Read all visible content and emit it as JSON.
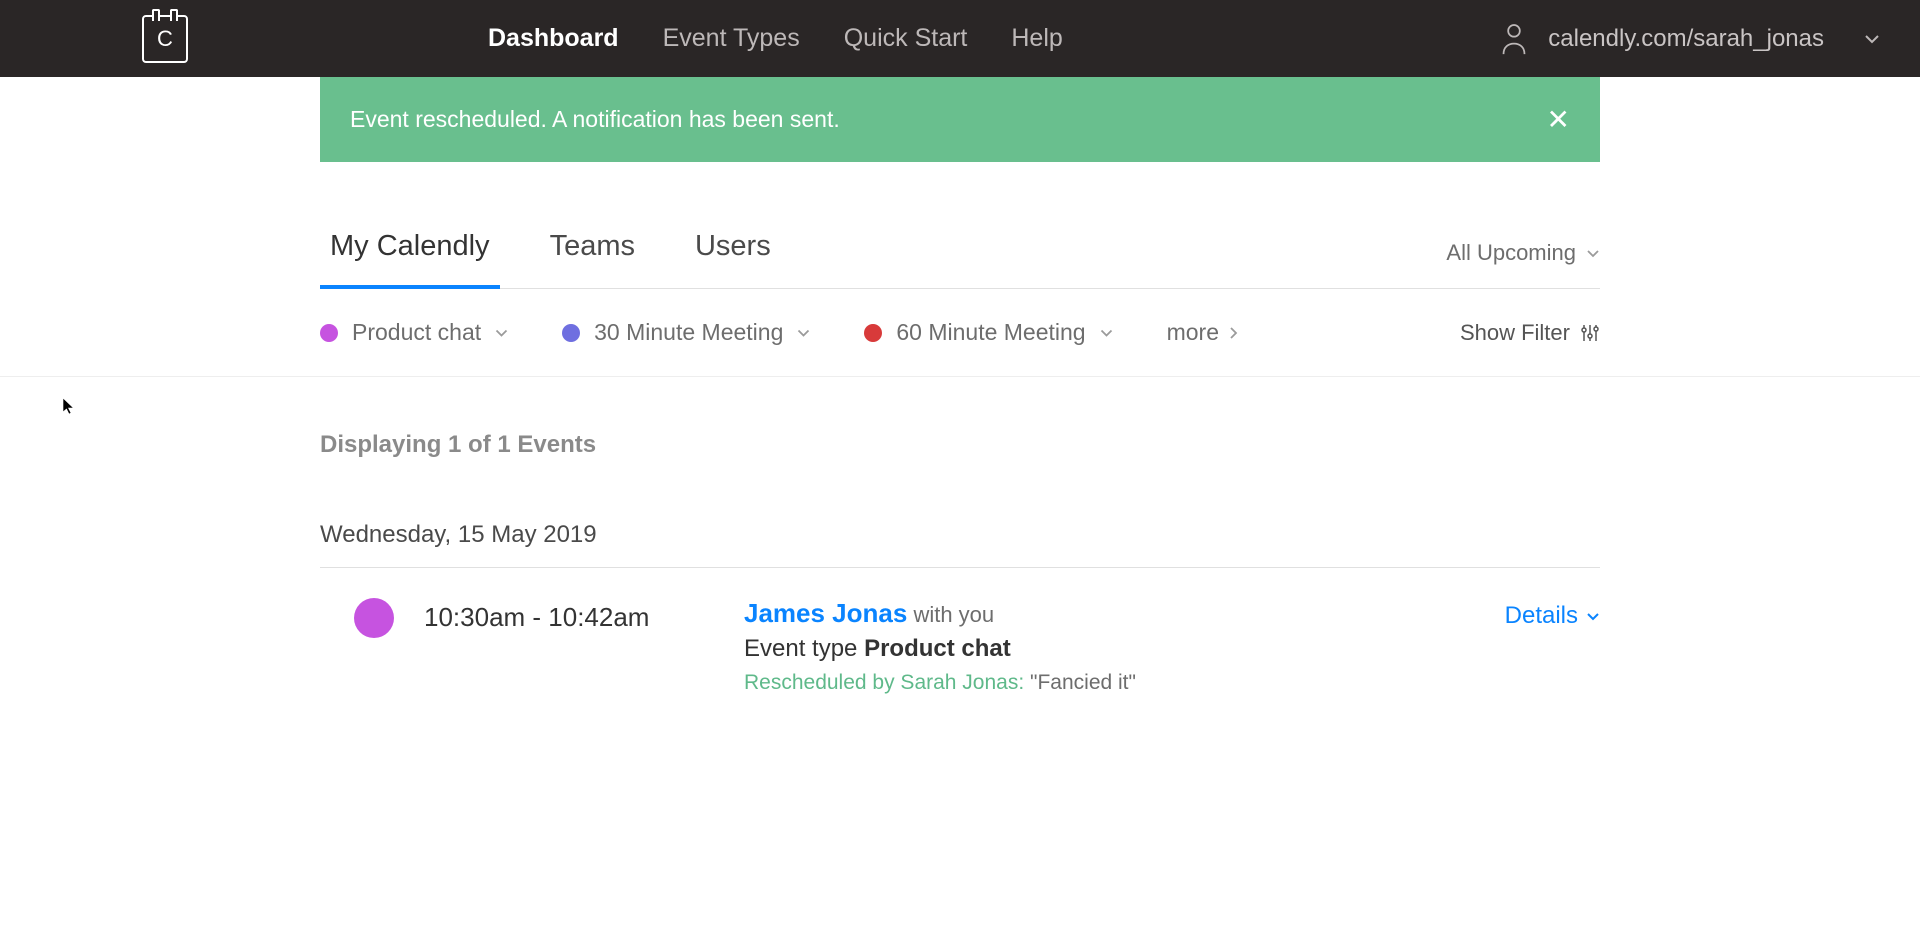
{
  "header": {
    "logo_letter": "C",
    "nav": {
      "dashboard": "Dashboard",
      "event_types": "Event Types",
      "quick_start": "Quick Start",
      "help": "Help"
    },
    "user_url": "calendly.com/sarah_jonas"
  },
  "banner": {
    "message": "Event rescheduled. A notification has been sent."
  },
  "tabs": {
    "my_calendly": "My Calendly",
    "teams": "Teams",
    "users": "Users"
  },
  "upcoming_filter": "All Upcoming",
  "event_type_chips": [
    {
      "label": "Product chat",
      "color": "#c653e0"
    },
    {
      "label": "30 Minute Meeting",
      "color": "#6f6fe0"
    },
    {
      "label": "60 Minute Meeting",
      "color": "#d83a3a"
    }
  ],
  "more_label": "more",
  "show_filter_label": "Show Filter",
  "count_line": "Displaying 1 of 1 Events",
  "date_heading": "Wednesday, 15 May 2019",
  "event": {
    "time": "10:30am - 10:42am",
    "invitee": "James Jonas",
    "with_label": " with you",
    "event_type_prefix": "Event type ",
    "event_type_name": "Product chat",
    "resched_prefix": "Rescheduled by Sarah Jonas:",
    "resched_reason": " \"Fancied it\"",
    "details_label": "Details",
    "dot_color": "#c653e0"
  }
}
